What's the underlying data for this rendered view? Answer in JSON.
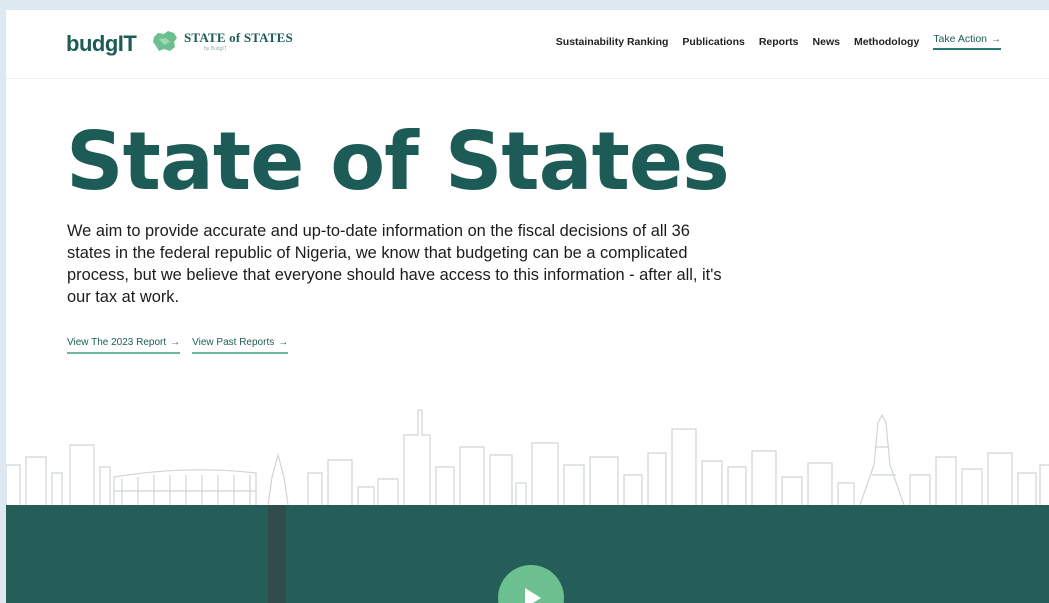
{
  "header": {
    "logo_text": "budgIT",
    "secondary_logo": {
      "main": "STATE of STATES",
      "sub": "by BudgIT"
    },
    "nav": [
      {
        "label": "Sustainability Ranking"
      },
      {
        "label": "Publications"
      },
      {
        "label": "Reports"
      },
      {
        "label": "News"
      },
      {
        "label": "Methodology"
      }
    ],
    "cta": {
      "label": "Take Action",
      "arrow": "→"
    }
  },
  "hero": {
    "title": "State of States",
    "description": "We aim to provide accurate and up-to-date information on the fiscal decisions of all 36 states in the federal republic of Nigeria, we know that budgeting can be a complicated process, but we believe that everyone should have access to this information - after all, it's our tax at work.",
    "links": [
      {
        "label": "View The 2023 Report",
        "arrow": "→"
      },
      {
        "label": "View Past Reports",
        "arrow": "→"
      }
    ]
  },
  "colors": {
    "brand": "#1d5c56",
    "accent": "#6cbf8f",
    "band": "#255e59"
  },
  "icons": {
    "play": "play-icon",
    "map": "nigeria-map-icon",
    "skyline": "skyline-illustration"
  }
}
